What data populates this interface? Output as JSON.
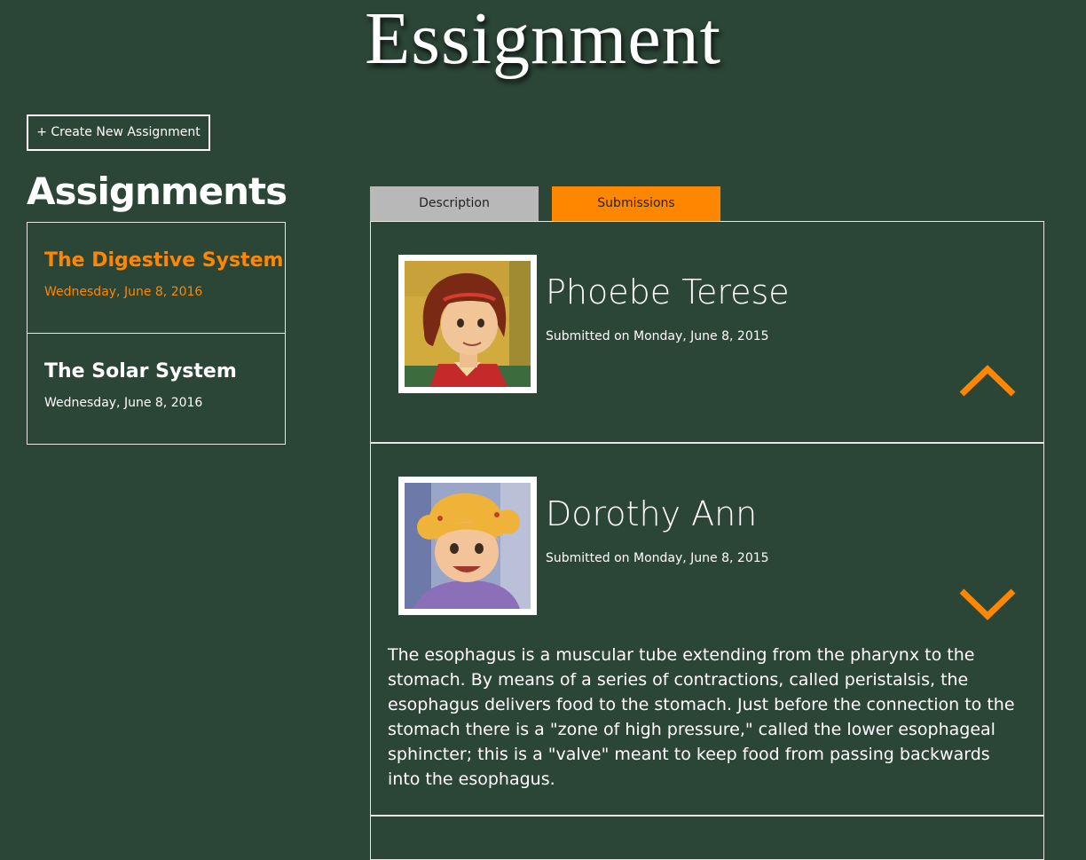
{
  "app": {
    "title": "Essignment"
  },
  "toolbar": {
    "create_label": "+ Create New Assignment"
  },
  "sidebar": {
    "heading": "Assignments",
    "items": [
      {
        "title": "The Digestive System",
        "date": "Wednesday, June 8, 2016",
        "active": true
      },
      {
        "title": "The Solar System",
        "date": "Wednesday, June 8, 2016",
        "active": false
      }
    ]
  },
  "tabs": [
    {
      "label": "Description",
      "active": false
    },
    {
      "label": "Submissions",
      "active": true
    }
  ],
  "submissions": [
    {
      "name": "Phoebe Terese",
      "submitted": "Submitted on Monday, June 8, 2015",
      "expanded": true,
      "chevron_icon": "chevron-up-icon"
    },
    {
      "name": "Dorothy Ann",
      "submitted": "Submitted on Monday, June 8, 2015",
      "expanded": true,
      "chevron_icon": "chevron-down-icon",
      "text": "The esophagus is a muscular tube extending from the pharynx to the stomach. By means of a series of contractions, called peristalsis, the esophagus delivers food to the stomach. Just before the connection to the stomach there is a \"zone of high pressure,\" called the lower esophageal sphincter; this is a \"valve\" meant to keep food from passing backwards into the esophagus."
    }
  ],
  "colors": {
    "background": "#2b4537",
    "accent": "#ff8700",
    "tab_inactive": "#b8b8b8",
    "border": "#e6e6e6"
  }
}
